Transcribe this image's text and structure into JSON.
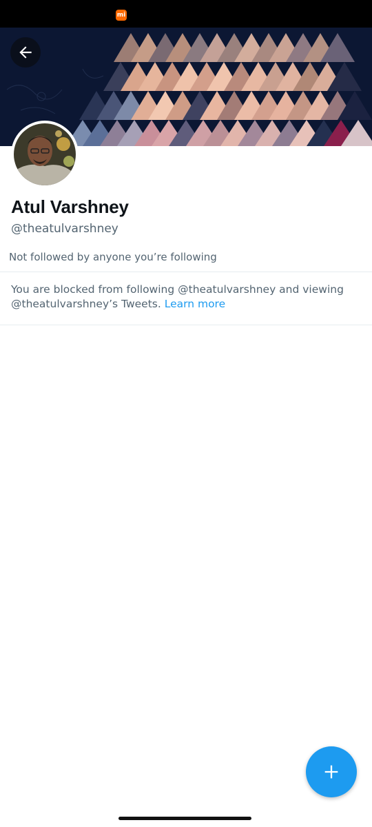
{
  "profile": {
    "name": "Atul Varshney",
    "handle": "@theatulvarshney",
    "followers_note": "Not followed by anyone you’re following"
  },
  "blocked": {
    "message": "You are blocked from following @theatulvarshney and viewing @theatulvarshney’s Tweets.",
    "link_label": "Learn more"
  },
  "colors": {
    "accent": "#1d9bf0",
    "text_primary": "#0f1419",
    "text_secondary": "#536471",
    "status_logo": "#ff6900"
  },
  "icons": {
    "back": "arrow-left-icon",
    "compose": "plus-icon",
    "status_logo": "mi-logo-icon"
  }
}
